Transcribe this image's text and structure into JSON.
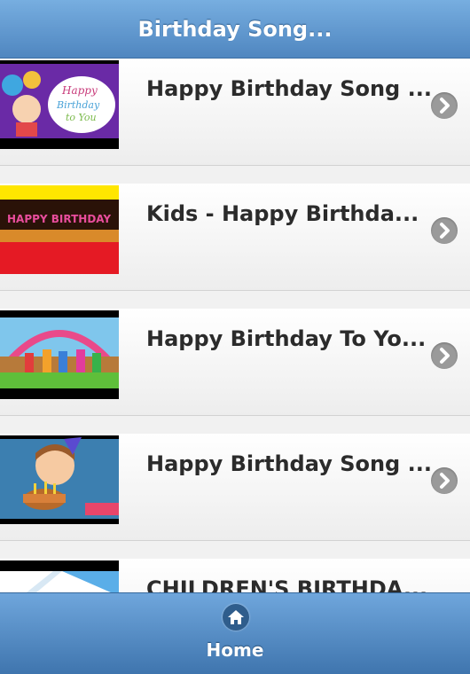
{
  "header": {
    "title": "Birthday Song..."
  },
  "videos": [
    {
      "title": "Happy Birthday Song ...",
      "thumb_icon": "happy-birthday-to-you-thumbnail"
    },
    {
      "title": "Kids - Happy Birthda...",
      "thumb_icon": "birthday-candles-thumbnail"
    },
    {
      "title": "Happy Birthday To Yo...",
      "thumb_icon": "party-kids-thumbnail"
    },
    {
      "title": "Happy Birthday Song ...",
      "thumb_icon": "boy-with-cake-thumbnail"
    },
    {
      "title": "CHILDREN'S BIRTHDA...",
      "thumb_icon": "blue-banner-thumbnail"
    }
  ],
  "thumb_text": {
    "happy": "Happy",
    "birthday": "Birthday",
    "to_you": "to You",
    "candles": "HAPPY BIRTHDAY"
  },
  "footer": {
    "home_label": "Home",
    "home_icon": "home-icon"
  },
  "colors": {
    "header": "#5f97d0",
    "footer": "#4a80b8",
    "chevron": "#9a9a9a"
  }
}
